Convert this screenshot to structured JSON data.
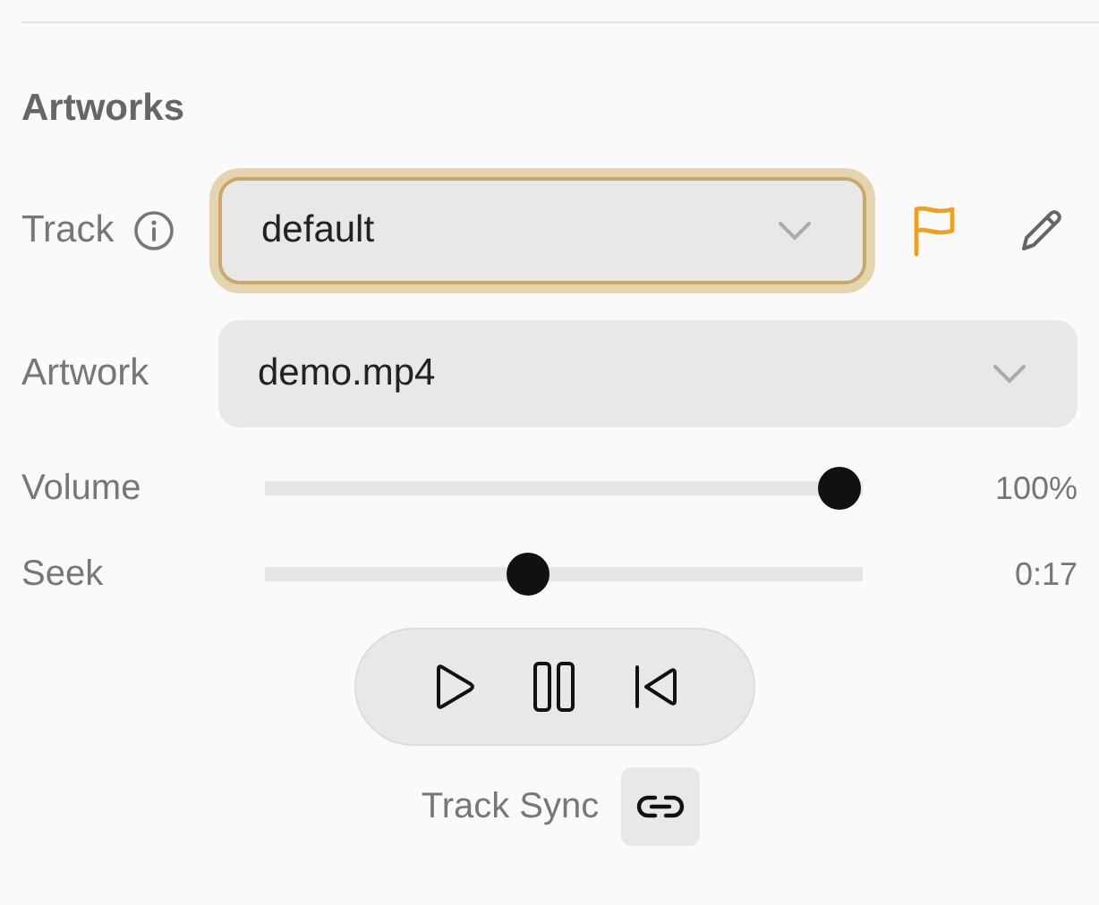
{
  "section": {
    "title": "Artworks"
  },
  "selects": [
    {
      "label": "Track",
      "value": "default",
      "info": true,
      "focused": true,
      "actions": true
    },
    {
      "label": "Artwork",
      "value": "demo.mp4",
      "info": false,
      "focused": false,
      "actions": false
    }
  ],
  "sliders": [
    {
      "label": "Volume",
      "level": 1,
      "reading": "100%"
    },
    {
      "label": "Seek",
      "level": 0.435,
      "reading": "0:17"
    }
  ],
  "transport": {
    "buttons": [
      {
        "kind": "play"
      },
      {
        "kind": "pause"
      },
      {
        "kind": "restart"
      }
    ]
  },
  "sync": {
    "label": "Track Sync"
  }
}
